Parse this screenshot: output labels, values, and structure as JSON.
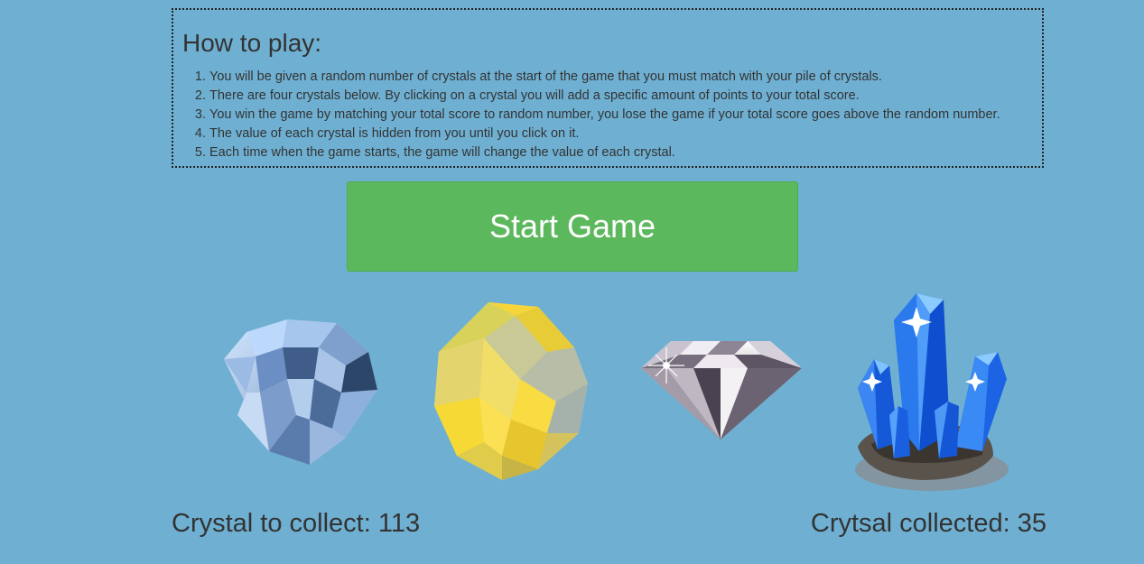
{
  "instructions": {
    "heading": "How to play:",
    "steps": [
      "You will be given a random number of crystals at the start of the game that you must match with your pile of crystals.",
      "There are four crystals below. By clicking on a crystal you will add a specific amount of points to your total score.",
      "You win the game by matching your total score to random number, you lose the game if your total score goes above the random number.",
      "The value of each crystal is hidden from you until you click on it.",
      "Each time when the game starts, the game will change the value of each crystal."
    ]
  },
  "start_button": {
    "label": "Start Game"
  },
  "crystals": [
    {
      "icon": "blue-diamond-icon"
    },
    {
      "icon": "yellow-gem-icon"
    },
    {
      "icon": "clear-diamond-icon"
    },
    {
      "icon": "blue-crystal-cluster-icon"
    }
  ],
  "score": {
    "target_text": "Crystal to collect: 113",
    "collected_text": "Crytsal collected: 35"
  },
  "colors": {
    "background": "#6fb0d2",
    "button": "#5cb85c",
    "text": "#333333"
  }
}
